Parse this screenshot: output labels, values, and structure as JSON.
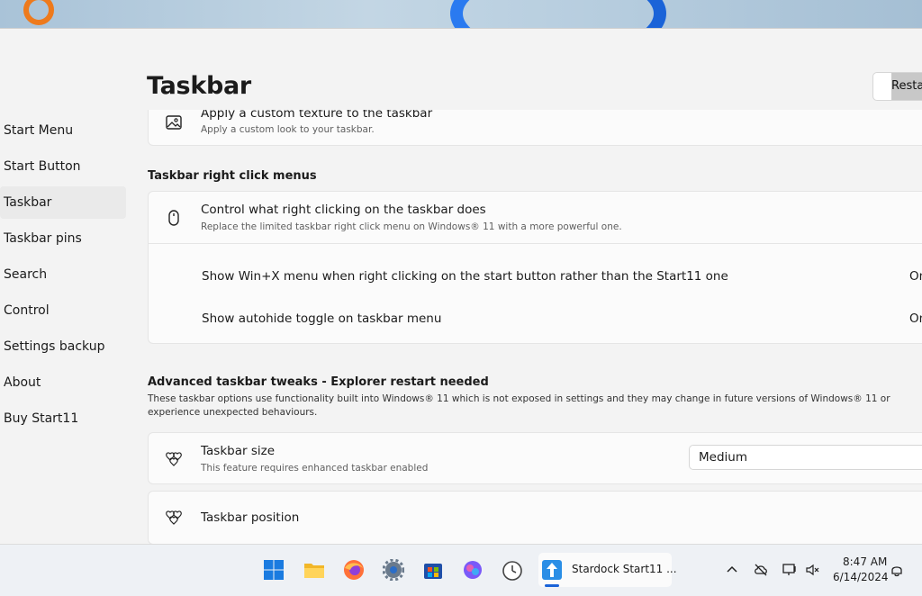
{
  "window": {
    "title": "Taskbar",
    "restart_button": "Restart"
  },
  "sidebar": {
    "items": [
      {
        "label": "Start Menu"
      },
      {
        "label": "Start Button"
      },
      {
        "label": "Taskbar"
      },
      {
        "label": "Taskbar pins"
      },
      {
        "label": "Search"
      },
      {
        "label": "Control"
      },
      {
        "label": "Settings backup"
      },
      {
        "label": "About"
      },
      {
        "label": "Buy Start11"
      }
    ],
    "active": "Taskbar"
  },
  "texture_card": {
    "title": "Apply a custom texture to the taskbar",
    "subtitle": "Apply a custom look to your taskbar.",
    "icon": "image-icon"
  },
  "right_click_section": {
    "heading": "Taskbar right click menus",
    "card": {
      "title": "Control what right clicking on the taskbar does",
      "subtitle": "Replace the limited taskbar right click menu on Windows® 11 with a more powerful one.",
      "icon": "mouse-icon"
    },
    "options": [
      {
        "label": "Show Win+X menu when right clicking on the start button rather than the Start11 one",
        "value": "On"
      },
      {
        "label": "Show autohide toggle on taskbar menu",
        "value": "On"
      }
    ]
  },
  "advanced_section": {
    "heading": "Advanced taskbar tweaks - Explorer restart needed",
    "description": "These taskbar options use functionality built into Windows® 11 which is not exposed in settings and they may change in future versions of Windows® 11 or experience unexpected behaviours.",
    "size_card": {
      "title": "Taskbar size",
      "subtitle": "This feature requires enhanced taskbar enabled",
      "value": "Medium",
      "icon": "hearts-icon"
    },
    "position_card": {
      "title": "Taskbar position",
      "icon": "hearts-icon"
    }
  },
  "taskbar": {
    "active_app": "Stardock Start11 ...",
    "time": "8:47 AM",
    "date": "6/14/2024",
    "icons": [
      "windows-icon",
      "file-explorer-icon",
      "firefox-icon",
      "settings-icon",
      "store-icon",
      "copilot-icon",
      "clock-app-icon",
      "start11-icon"
    ],
    "accent": "#1a63d8"
  }
}
